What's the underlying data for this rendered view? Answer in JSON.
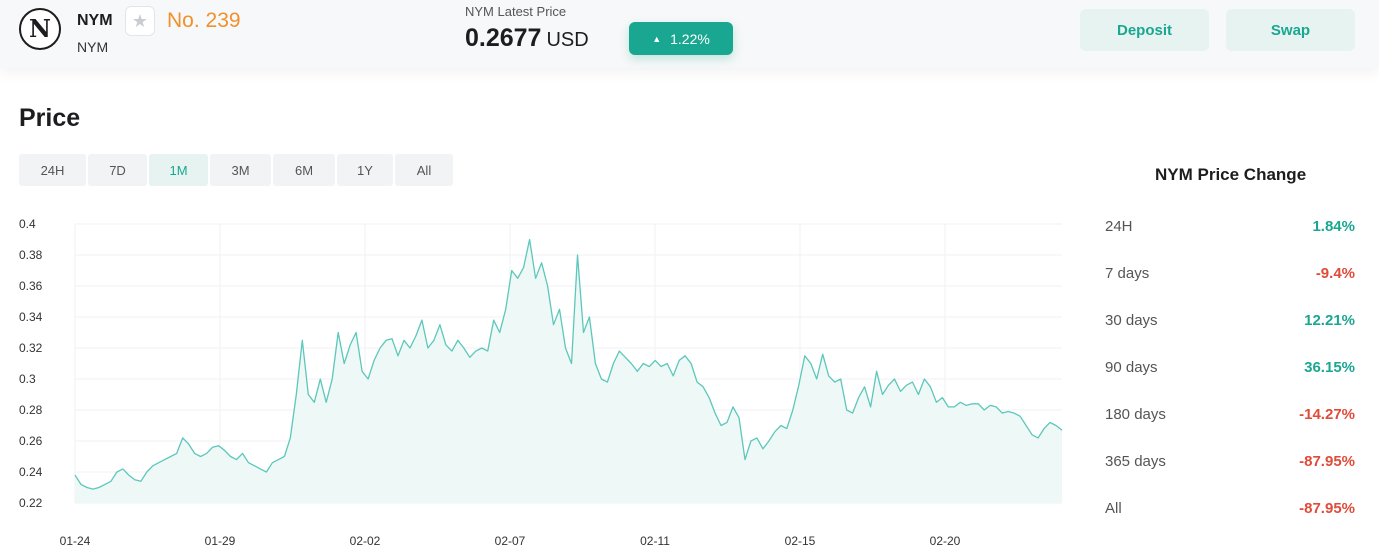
{
  "header": {
    "logo_letter": "N",
    "coin_name": "NYM",
    "coin_symbol": "NYM",
    "star_icon": "star-icon",
    "rank": "No. 239",
    "latest_price_label": "NYM Latest Price",
    "price": "0.2677",
    "price_unit": "USD",
    "change_arrow_icon": "triangle-up-icon",
    "change": "1.22%",
    "deposit_label": "Deposit",
    "swap_label": "Swap"
  },
  "section_title": "Price",
  "range_tabs": [
    {
      "label": "24H",
      "active": false
    },
    {
      "label": "7D",
      "active": false
    },
    {
      "label": "1M",
      "active": true
    },
    {
      "label": "3M",
      "active": false
    },
    {
      "label": "6M",
      "active": false
    },
    {
      "label": "1Y",
      "active": false
    },
    {
      "label": "All",
      "active": false
    }
  ],
  "chart_data": {
    "type": "area",
    "x_ticks": [
      "01-24",
      "01-29",
      "02-02",
      "02-07",
      "02-11",
      "02-15",
      "02-20"
    ],
    "y_ticks": [
      "0.4",
      "0.38",
      "0.36",
      "0.34",
      "0.32",
      "0.3",
      "0.28",
      "0.26",
      "0.24",
      "0.22"
    ],
    "ylim": [
      0.22,
      0.4
    ],
    "grid": true,
    "line_color": "#5cc7bb",
    "fill_color": "#eef8f6",
    "series": [
      {
        "values": [
          0.238,
          0.232,
          0.23,
          0.229,
          0.23,
          0.232,
          0.234,
          0.24,
          0.242,
          0.238,
          0.235,
          0.234,
          0.24,
          0.244,
          0.246,
          0.248,
          0.25,
          0.252,
          0.262,
          0.258,
          0.252,
          0.25,
          0.252,
          0.256,
          0.257,
          0.254,
          0.25,
          0.248,
          0.252,
          0.246,
          0.244,
          0.242,
          0.24,
          0.246,
          0.248,
          0.25,
          0.262,
          0.29,
          0.325,
          0.29,
          0.285,
          0.3,
          0.285,
          0.3,
          0.33,
          0.31,
          0.322,
          0.33,
          0.305,
          0.3,
          0.312,
          0.32,
          0.325,
          0.326,
          0.315,
          0.325,
          0.32,
          0.328,
          0.338,
          0.32,
          0.325,
          0.335,
          0.322,
          0.318,
          0.325,
          0.32,
          0.314,
          0.318,
          0.32,
          0.318,
          0.338,
          0.33,
          0.345,
          0.37,
          0.365,
          0.372,
          0.39,
          0.365,
          0.375,
          0.36,
          0.335,
          0.345,
          0.32,
          0.31,
          0.38,
          0.33,
          0.34,
          0.31,
          0.3,
          0.298,
          0.31,
          0.318,
          0.314,
          0.31,
          0.305,
          0.31,
          0.308,
          0.312,
          0.308,
          0.31,
          0.302,
          0.312,
          0.315,
          0.31,
          0.298,
          0.295,
          0.288,
          0.278,
          0.27,
          0.272,
          0.282,
          0.275,
          0.248,
          0.26,
          0.262,
          0.255,
          0.26,
          0.266,
          0.27,
          0.268,
          0.28,
          0.296,
          0.315,
          0.31,
          0.3,
          0.316,
          0.302,
          0.298,
          0.3,
          0.28,
          0.278,
          0.288,
          0.295,
          0.282,
          0.305,
          0.29,
          0.296,
          0.3,
          0.292,
          0.296,
          0.298,
          0.29,
          0.3,
          0.295,
          0.285,
          0.288,
          0.282,
          0.282,
          0.285,
          0.283,
          0.284,
          0.284,
          0.28,
          0.283,
          0.282,
          0.278,
          0.279,
          0.278,
          0.276,
          0.27,
          0.264,
          0.262,
          0.268,
          0.272,
          0.27,
          0.267
        ]
      }
    ]
  },
  "side_panel": {
    "title": "NYM Price Change",
    "rows": [
      {
        "label": "24H",
        "value": "1.84%",
        "color": "#1aa791"
      },
      {
        "label": "7 days",
        "value": "-9.4%",
        "color": "#e04b3a"
      },
      {
        "label": "30 days",
        "value": "12.21%",
        "color": "#1aa791"
      },
      {
        "label": "90 days",
        "value": "36.15%",
        "color": "#1aa791"
      },
      {
        "label": "180 days",
        "value": "-14.27%",
        "color": "#e04b3a"
      },
      {
        "label": "365 days",
        "value": "-87.95%",
        "color": "#e04b3a"
      },
      {
        "label": "All",
        "value": "-87.95%",
        "color": "#e04b3a"
      }
    ]
  }
}
